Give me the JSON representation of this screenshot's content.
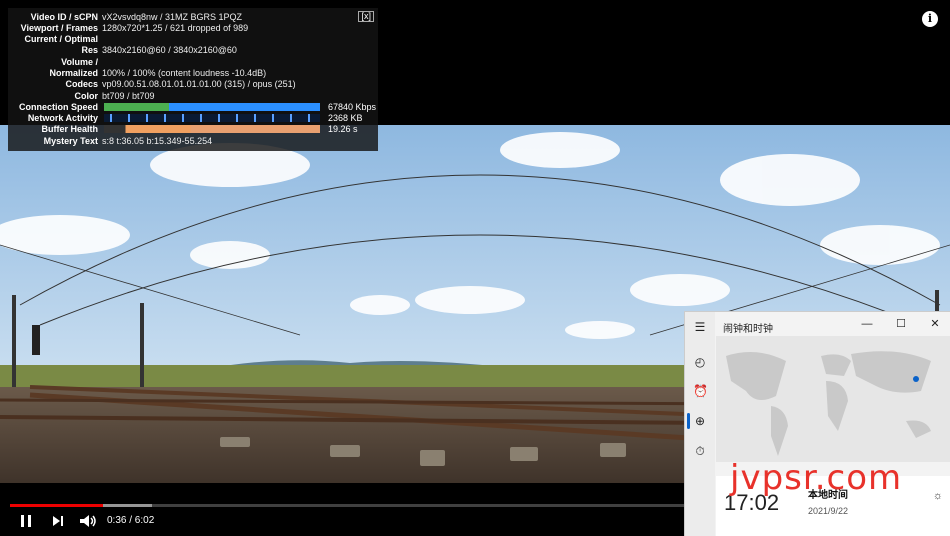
{
  "stats": {
    "close_label": "[x]",
    "rows": [
      {
        "label": "Video ID / sCPN",
        "value": "vX2vsvdq8nw / 31MZ BGRS 1PQZ"
      },
      {
        "label": "Viewport / Frames",
        "value": "1280x720*1.25 / 621 dropped of 989"
      },
      {
        "label": "Current / Optimal",
        "value": ""
      },
      {
        "label": "Res",
        "value": "3840x2160@60 / 3840x2160@60"
      },
      {
        "label": "Volume /",
        "value": ""
      },
      {
        "label": "Normalized",
        "value": "100% / 100% (content loudness -10.4dB)"
      },
      {
        "label": "Codecs",
        "value": "vp09.00.51.08.01.01.01.01.00 (315) / opus (251)"
      },
      {
        "label": "Color",
        "value": "bt709 / bt709"
      }
    ],
    "bars": [
      {
        "label": "Connection Speed",
        "value": "67840 Kbps",
        "color": "#2b8fff"
      },
      {
        "label": "Network Activity",
        "value": "2368 KB",
        "color": "#5aa0ff"
      },
      {
        "label": "Buffer Health",
        "value": "19.26 s",
        "color": "#f0a060"
      }
    ],
    "mystery": {
      "label": "Mystery Text",
      "value": "s:8 t:36.05 b:15.349-55.254"
    }
  },
  "info_icon": "i",
  "player": {
    "current_time": "0:36",
    "duration": "6:02",
    "time_display": "0:36 / 6:02",
    "played_fraction": 0.1,
    "buffered_fraction": 0.153,
    "icons": {
      "play": "pause-icon",
      "next": "next-icon",
      "volume": "volume-icon"
    }
  },
  "clock_app": {
    "title": "闹钟和时钟",
    "window": {
      "minimize": "—",
      "maximize": "☐",
      "close": "✕"
    },
    "nav_icons": [
      "menu-icon",
      "timer-icon",
      "alarm-icon",
      "world-clock-icon",
      "stopwatch-icon"
    ],
    "local_time": "17:02",
    "place": "本地时间",
    "date": "2021/9/22"
  },
  "watermark": "jvpsr.com",
  "colors": {
    "accent_red": "#e00000",
    "sky": "#9fc5e8",
    "clock_accent": "#0a62c9"
  }
}
